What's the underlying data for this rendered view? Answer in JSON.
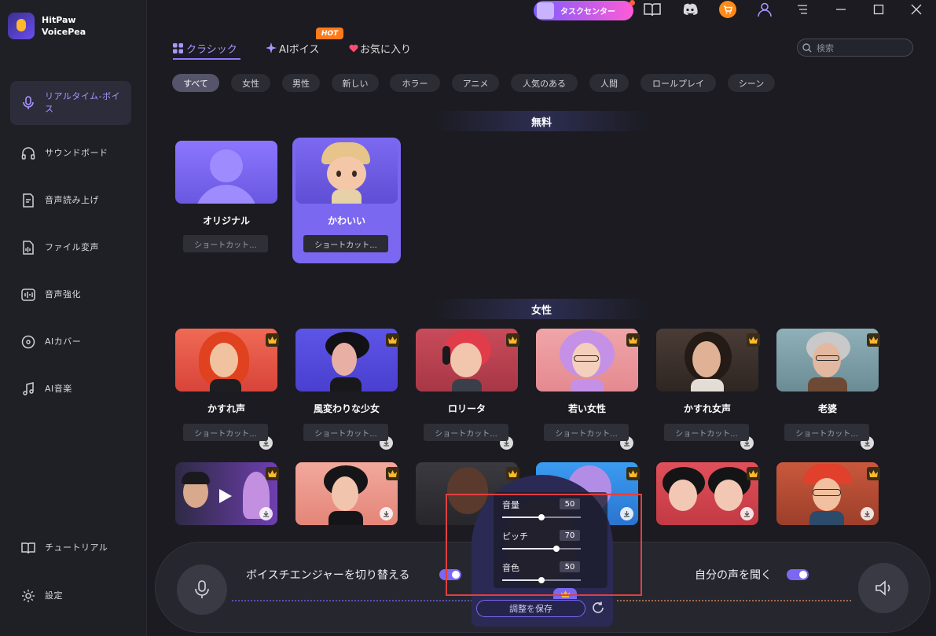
{
  "app": {
    "name_line1": "HitPaw",
    "name_line2": "VoicePea"
  },
  "sidebar": {
    "items": [
      {
        "label": "リアルタイム-ボイス",
        "icon": "microphone-icon",
        "active": true
      },
      {
        "label": "サウンドボード",
        "icon": "headphones-icon"
      },
      {
        "label": "音声読み上げ",
        "icon": "text-to-speech-icon"
      },
      {
        "label": "ファイル変声",
        "icon": "audio-file-icon"
      },
      {
        "label": "音声強化",
        "icon": "enhance-icon"
      },
      {
        "label": "AIカバー",
        "icon": "disc-icon"
      },
      {
        "label": "AI音楽",
        "icon": "music-note-icon"
      }
    ],
    "tutorial": "チュートリアル",
    "settings": "設定"
  },
  "topbar": {
    "task_center": "タスクセンター"
  },
  "tabs": [
    {
      "label": "クラシック",
      "active": true
    },
    {
      "label": "AIボイス",
      "badge": "HOT"
    },
    {
      "label": "お気に入り"
    }
  ],
  "search": {
    "placeholder": "検索"
  },
  "filters": [
    "すべて",
    "女性",
    "男性",
    "新しい",
    "ホラー",
    "アニメ",
    "人気のある",
    "人間",
    "ロールプレイ",
    "シーン"
  ],
  "sections": {
    "free": {
      "title": "無料"
    },
    "female": {
      "title": "女性"
    }
  },
  "free_cards": [
    {
      "name": "オリジナル",
      "shortcut": "ショートカット..."
    },
    {
      "name": "かわいい",
      "shortcut": "ショートカット...",
      "selected": true
    }
  ],
  "female_cards_row1": [
    {
      "name": "かすれ声",
      "shortcut": "ショートカット..."
    },
    {
      "name": "風変わりな少女",
      "shortcut": "ショートカット..."
    },
    {
      "name": "ロリータ",
      "shortcut": "ショートカット..."
    },
    {
      "name": "若い女性",
      "shortcut": "ショートカット..."
    },
    {
      "name": "かすれ女声",
      "shortcut": "ショートカット..."
    },
    {
      "name": "老婆",
      "shortcut": "ショートカット..."
    }
  ],
  "bottom": {
    "switch_label": "ボイスチエンジャーを切り替える",
    "listen_label": "自分の声を聞く"
  },
  "adjust": {
    "volume_label": "音量",
    "volume_value": "50",
    "pitch_label": "ピッチ",
    "pitch_value": "70",
    "timbre_label": "音色",
    "timbre_value": "50",
    "save_label": "調整を保存"
  },
  "colors": {
    "accent": "#7b68f0",
    "background": "#1b1b21"
  }
}
